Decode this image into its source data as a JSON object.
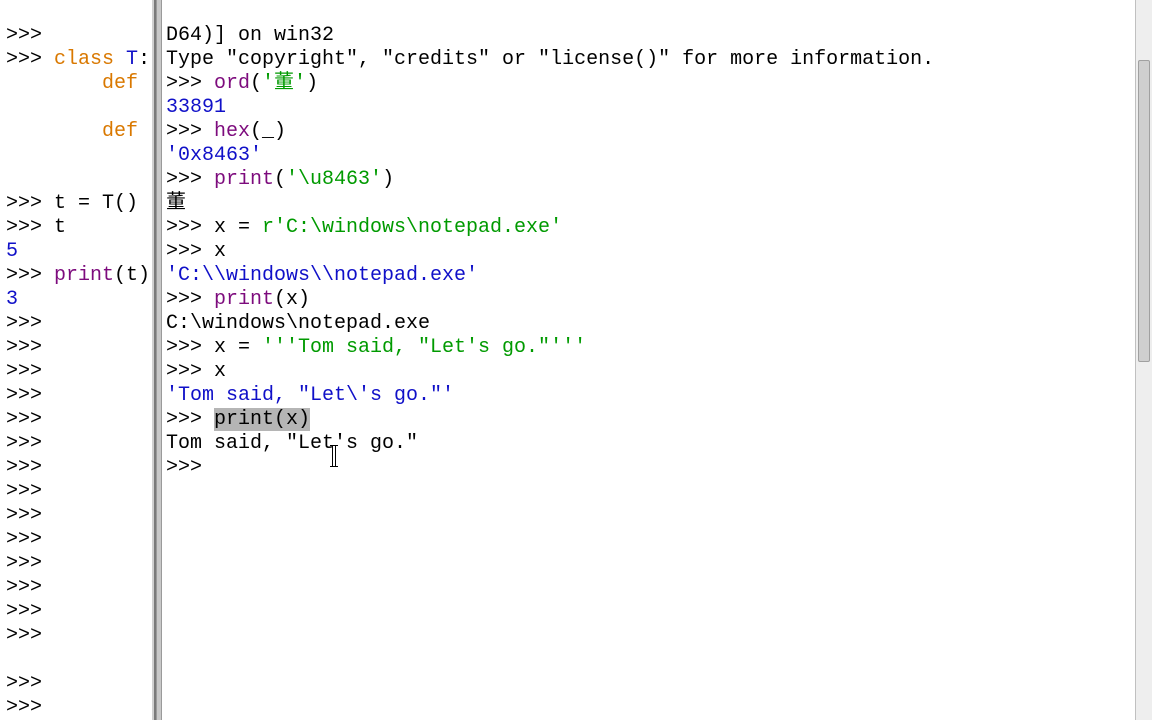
{
  "left": {
    "l01": ">>> ",
    "l02a": ">>> ",
    "l02b": "class",
    "l02c": " ",
    "l02d": "T",
    "l02e": ":",
    "l03a": "        ",
    "l03b": "def",
    "l04": "",
    "l05a": "        ",
    "l05b": "def",
    "l06": "",
    "l07": "",
    "l08": ">>> t = T()",
    "l09": ">>> t",
    "l10": "5",
    "l11a": ">>> ",
    "l11b": "print",
    "l11c": "(t)",
    "l12": "3",
    "l13": ">>> ",
    "l14": ">>> ",
    "l15": ">>> ",
    "l16": ">>> ",
    "l17": ">>> ",
    "l18": ">>> ",
    "l19": ">>> ",
    "l20": ">>> ",
    "l21": ">>> ",
    "l22": ">>> ",
    "l23": ">>> ",
    "l24": ">>> ",
    "l25": ">>> ",
    "l26": ">>> ",
    "l27": "",
    "l28": ">>> ",
    "l29": ">>> "
  },
  "right": {
    "r01": "D64)] on win32",
    "r02": "Type \"copyright\", \"credits\" or \"license()\" for more information.",
    "r03a": ">>> ",
    "r03b": "ord",
    "r03c": "(",
    "r03d": "'董'",
    "r03e": ")",
    "r04": "33891",
    "r05a": ">>> ",
    "r05b": "hex",
    "r05c": "(_)",
    "r06": "'0x8463'",
    "r07a": ">>> ",
    "r07b": "print",
    "r07c": "(",
    "r07d": "'\\u8463'",
    "r07e": ")",
    "r08": "董",
    "r09a": ">>> x = ",
    "r09b": "r'C:\\windows\\notepad.exe'",
    "r10": ">>> x",
    "r11": "'C:\\\\windows\\\\notepad.exe'",
    "r12a": ">>> ",
    "r12b": "print",
    "r12c": "(x)",
    "r13": "C:\\windows\\notepad.exe",
    "r14a": ">>> x = ",
    "r14b": "'''Tom said, \"Let's go.\"'''",
    "r15": ">>> x",
    "r16": "'Tom said, \"Let\\'s go.\"'",
    "r17a": ">>> ",
    "r17b": "print(x)",
    "r18": "Tom said, \"Let's go.\"",
    "r19": ">>> "
  }
}
